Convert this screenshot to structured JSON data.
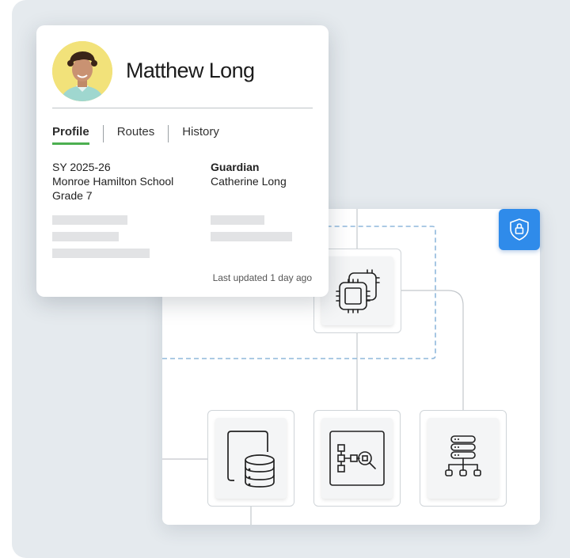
{
  "profile": {
    "name": "Matthew Long",
    "tabs": [
      {
        "label": "Profile",
        "active": true
      },
      {
        "label": "Routes",
        "active": false
      },
      {
        "label": "History",
        "active": false
      }
    ],
    "school_year": "SY 2025-26",
    "school": "Monroe Hamilton School",
    "grade": "Grade 7",
    "guardian_label": "Guardian",
    "guardian_name": "Catherine Long",
    "last_updated": "Last updated 1 day ago"
  },
  "diagram": {
    "badge_icon": "shield-lock-icon",
    "nodes": [
      {
        "id": "processor",
        "icon": "cpu-chip-icon"
      },
      {
        "id": "database",
        "icon": "database-document-icon"
      },
      {
        "id": "search",
        "icon": "flowchart-search-icon"
      },
      {
        "id": "network",
        "icon": "server-network-icon"
      }
    ]
  },
  "colors": {
    "accent_tab": "#4caf50",
    "badge_blue": "#2f8bea",
    "dashed_outline": "#8fb8dc",
    "background": "#e5eaee"
  }
}
